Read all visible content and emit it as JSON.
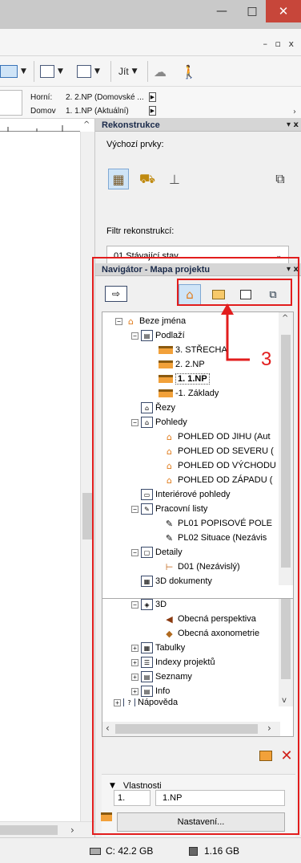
{
  "window": {
    "min_glyph": "—",
    "max_glyph": "□",
    "close_glyph": "✕",
    "mdi_controls": "– ▫ x"
  },
  "toolbar": {
    "goto_label": "Jít"
  },
  "floors": {
    "upper_label": "Horní:",
    "upper_value": "2. 2.NP (Domovské ...",
    "home_label": "Domov",
    "home_value": "1. 1.NP (Aktuální)"
  },
  "reconstruction": {
    "title": "Rekonstrukce",
    "default_elements_label": "Výchozí prvky:",
    "filter_label": "Filtr rekonstrukcí:",
    "filter_value": "01 Stávající stav"
  },
  "navigator": {
    "title": "Navigátor - Mapa projektu",
    "tree": {
      "root": "Beze jména",
      "stories": "Podlaží",
      "story_3": "3. STŘECHA",
      "story_2": "2. 2.NP",
      "story_1": "1. 1.NP",
      "story_m1": "-1. Základy",
      "sections": "Řezy",
      "elevations": "Pohledy",
      "elev_south": "POHLED OD JIHU (Aut",
      "elev_north": "POHLED OD SEVERU (",
      "elev_east": "POHLED OD VÝCHODU",
      "elev_west": "POHLED OD ZÁPADU (",
      "interior": "Interiérové pohledy",
      "worksheets": "Pracovní listy",
      "ws_pl01": "PL01 POPISOVÉ POLE",
      "ws_pl02": "PL02 Situace (Nezávis",
      "details": "Detaily",
      "detail_d01": "D01 (Nezávislý)",
      "docs3d": "3D dokumenty",
      "threed": "3D",
      "perspective": "Obecná perspektiva",
      "axonometry": "Obecná axonometrie",
      "schedules": "Tabulky",
      "indexes": "Indexy projektů",
      "lists": "Seznamy",
      "info": "Info",
      "help": "Nápověda"
    },
    "properties_label": "Vlastnosti",
    "prop_number": "1.",
    "prop_name": "1.NP",
    "settings_button": "Nastavení..."
  },
  "annotation": {
    "number": "3",
    "color": "#e21d1d"
  },
  "status": {
    "disk": "C: 42.2 GB",
    "memory": "1.16 GB"
  }
}
